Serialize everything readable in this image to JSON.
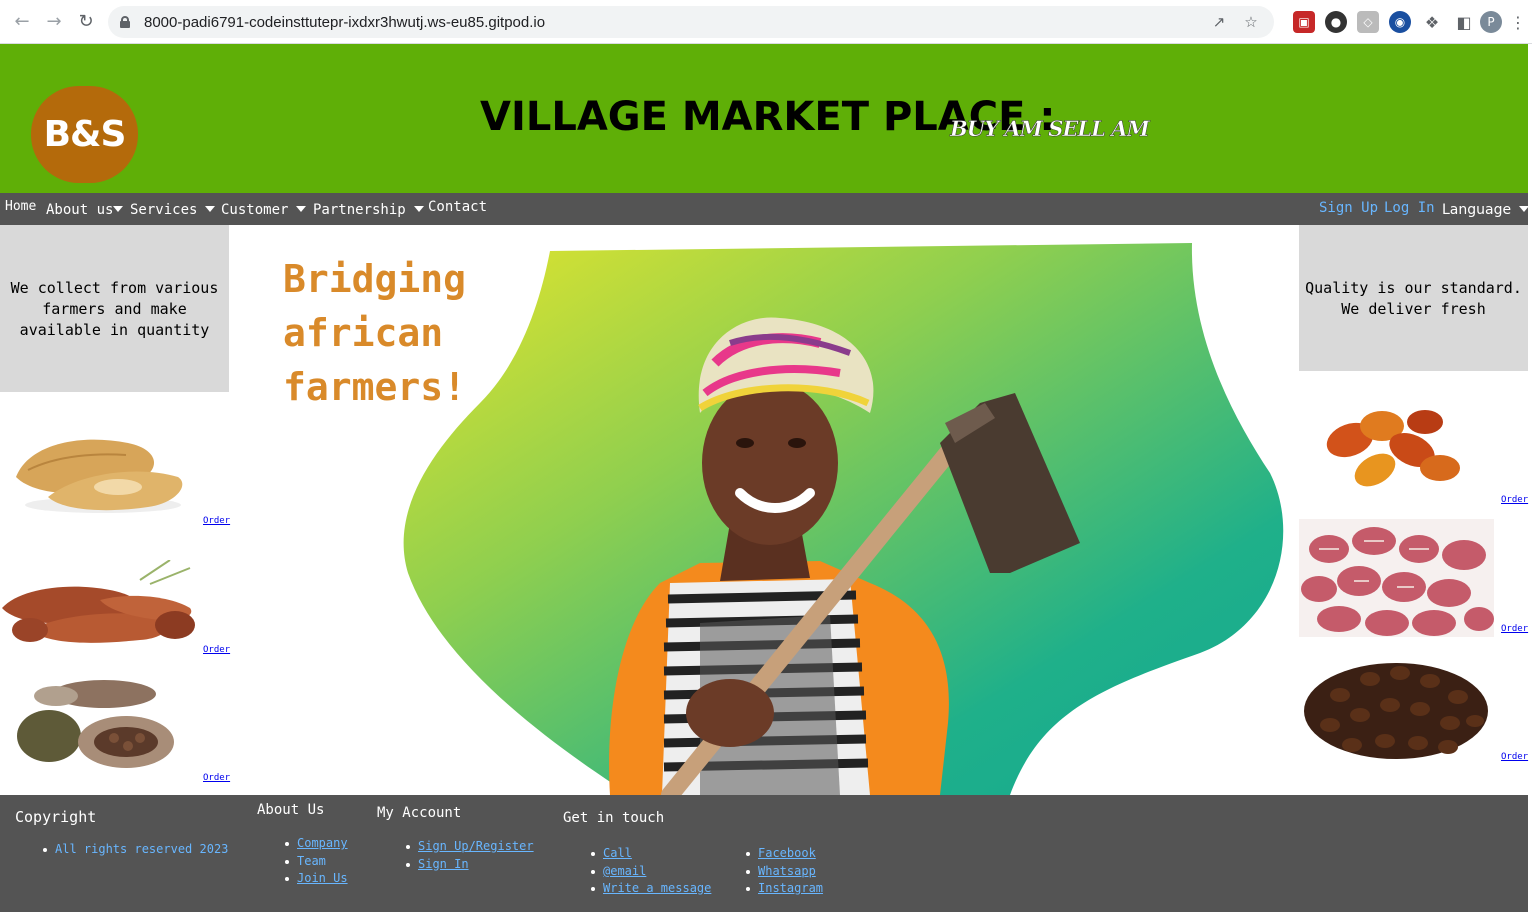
{
  "browser": {
    "url": "8000-padi6791-codeinsttutepr-ixdxr3hwutj.ws-eu85.gitpod.io",
    "profile_initial": "P"
  },
  "header": {
    "logo_text": "B&S",
    "title": "VILLAGE MARKET PLACE :",
    "tagline": "BUY AM SELL AM",
    "background": "#5faf07"
  },
  "nav": {
    "items": [
      {
        "label": "Home",
        "dropdown": false
      },
      {
        "label": "About us",
        "dropdown": true
      },
      {
        "label": "Services",
        "dropdown": true
      },
      {
        "label": "Customer",
        "dropdown": true
      },
      {
        "label": "Partnership",
        "dropdown": true
      },
      {
        "label": "Contact",
        "dropdown": false
      }
    ],
    "sign_up": "Sign Up",
    "log_in": "Log In",
    "language": "Language"
  },
  "left_panel": {
    "text": "We collect from various farmers and make available in quantity",
    "products": [
      {
        "name": "yam-image",
        "order": "Order"
      },
      {
        "name": "cassava-image",
        "order": "Order"
      },
      {
        "name": "cocoa-pods-image",
        "order": "Order"
      }
    ]
  },
  "right_panel": {
    "text": "Quality is our standard. We deliver fresh",
    "products": [
      {
        "name": "palm-fruits-image",
        "order": "Order"
      },
      {
        "name": "kola-nuts-image",
        "order": "Order"
      },
      {
        "name": "coffee-beans-image",
        "order": "Order"
      }
    ]
  },
  "hero": {
    "line1": "Bridging",
    "line2": "african",
    "line3": "farmers!",
    "text_color": "#d98a2a",
    "blob_gradient": [
      "#e4e52c",
      "#8fcf4f",
      "#1fb08a",
      "#13a891"
    ]
  },
  "footer": {
    "copyright": {
      "title": "Copyright",
      "items": [
        "All rights reserved 2023"
      ]
    },
    "about": {
      "title": "About Us",
      "items": [
        "Company",
        "Team",
        "Join Us"
      ]
    },
    "account": {
      "title": "My Account",
      "items": [
        "Sign Up/Register",
        "Sign In"
      ]
    },
    "contact": {
      "title": "Get in touch",
      "col1": [
        "Call",
        "@email",
        "Write a message"
      ],
      "col2": [
        "Facebook",
        "Whatsapp",
        "Instagram"
      ]
    },
    "link_color": "#68b6ff",
    "background": "#545454"
  }
}
